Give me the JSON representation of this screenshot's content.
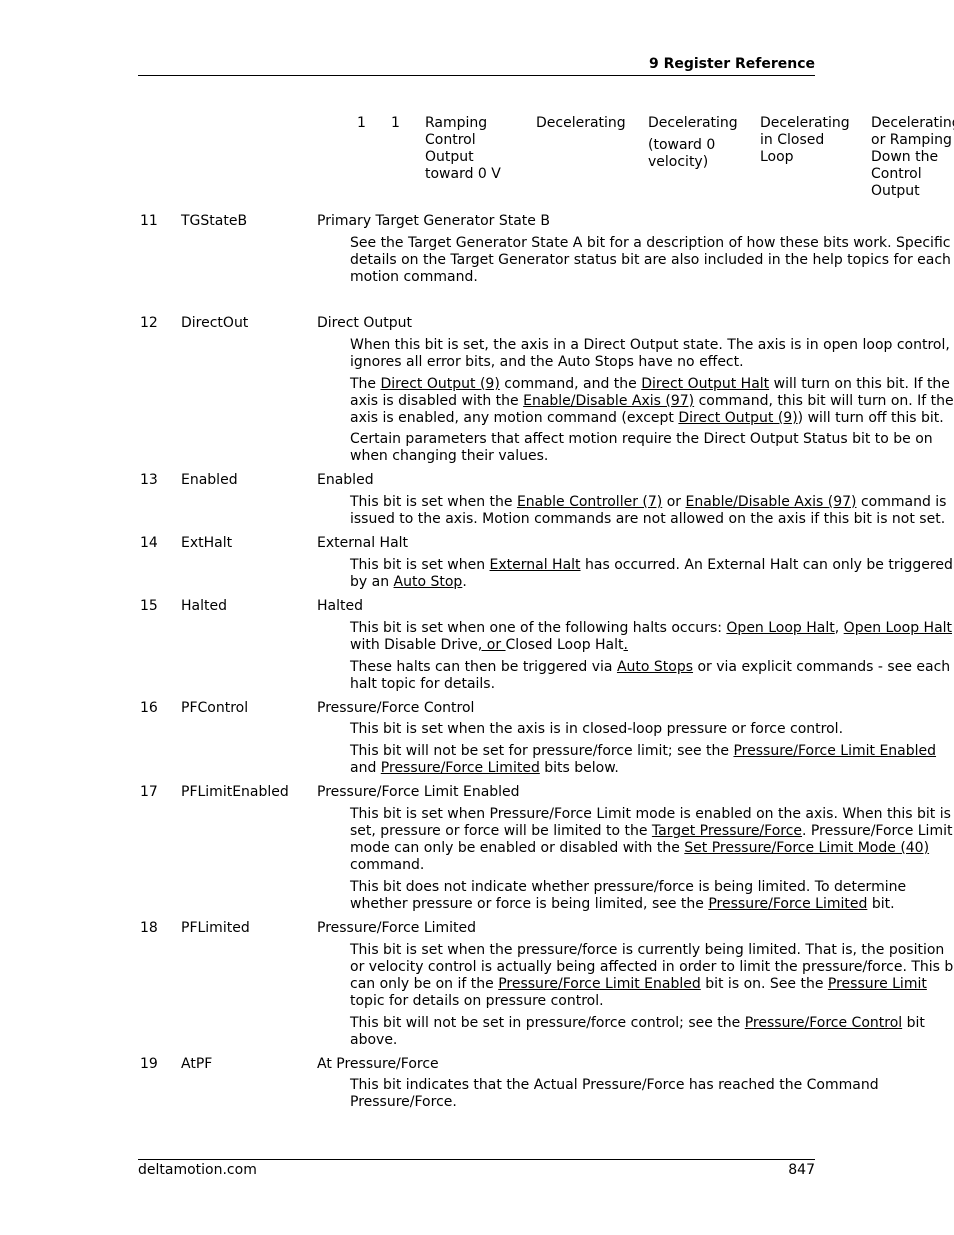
{
  "header": {
    "title": "9  Register Reference"
  },
  "table_row": {
    "col_a": "1",
    "col_b": "1",
    "cells": [
      [
        "Ramping",
        "Control",
        "Output",
        "toward 0 V"
      ],
      [
        "Decelerating"
      ],
      [
        "Decelerating",
        "(toward 0",
        "velocity)"
      ],
      [
        "Decelerating",
        "in Closed",
        "Loop"
      ],
      [
        "Decelerating",
        "or Ramping",
        "Down the",
        "Control",
        "Output"
      ]
    ]
  },
  "bits": [
    {
      "num": "11",
      "name": "TGStateB",
      "title": "Primary Target Generator State B",
      "lines": [
        "See the Target Generator State A bit for a description of how these bits work. Specific",
        "details on the Target Generator status bit are also included in the help topics for each",
        "motion command."
      ]
    },
    {
      "num": "12",
      "name": "DirectOut",
      "title": "Direct Output",
      "lines": [
        "When this bit is set, the axis in a Direct Output state. The axis is in open loop control,",
        "ignores all error bits, and the Auto Stops have no effect.",
        "The |Direct Output (9)| command, and the |Direct Output Halt| will turn on this bit. If the",
        "axis is disabled with the |Enable/Disable Axis (97)| command, this bit will turn on. If the",
        "axis is enabled, any motion command (except |Direct Output (9)|) will turn off this bit.",
        "Certain parameters that affect motion require the Direct Output Status bit to be on",
        "when changing their values."
      ]
    },
    {
      "num": "13",
      "name": "Enabled",
      "title": "Enabled",
      "lines": [
        "This bit is set when the |Enable Controller (7)| or |Enable/Disable Axis (97)| command is",
        "issued to the axis.  Motion commands are not allowed on the axis if this bit is not set."
      ]
    },
    {
      "num": "14",
      "name": "ExtHalt",
      "title": "External Halt",
      "lines": [
        "This bit is set when |External Halt| has occurred. An External Halt can only be triggered",
        "by an |Auto Stop|."
      ]
    },
    {
      "num": "15",
      "name": "Halted",
      "title": "Halted",
      "lines": [
        "This bit is set when one of the following halts occurs: |Open Loop Halt|, |Open Loop Halt",
        "with Disable Drive|, or |Closed Loop Halt|.",
        "These halts can then be triggered via |Auto Stops| or via explicit commands - see each",
        "halt topic for details."
      ]
    },
    {
      "num": "16",
      "name": "PFControl",
      "title": "Pressure/Force Control",
      "lines": [
        "This bit is set when the axis is in closed-loop pressure or force control.",
        "This bit will not be set for pressure/force limit; see the |Pressure/Force Limit Enabled|",
        "and |Pressure/Force Limited| bits below."
      ]
    },
    {
      "num": "17",
      "name": "PFLimitEnabled",
      "title": "Pressure/Force Limit Enabled",
      "lines": [
        "This bit is set when Pressure/Force Limit mode is enabled on the axis. When this bit is",
        "set, pressure or force will be limited to the |Target Pressure/Force|. Pressure/Force Limit",
        "mode can only be enabled or disabled with the |Set Pressure/Force Limit Mode (40)|",
        "command.",
        "This bit does not indicate whether pressure/force is being limited. To determine",
        "whether pressure or force is being limited, see the |Pressure/Force Limited| bit."
      ]
    },
    {
      "num": "18",
      "name": "PFLimited",
      "title": "Pressure/Force Limited",
      "lines": [
        "This bit is set when the pressure/force is currently being limited. That is, the position",
        "or velocity control is actually being affected in order to limit the pressure/force. This bit",
        "can only be on if the |Pressure/Force Limit Enabled| bit is on. See the |Pressure Limit|",
        "topic for details on pressure control.",
        "This bit will not be set in pressure/force control; see the |Pressure/Force Control| bit",
        "above."
      ]
    },
    {
      "num": "19",
      "name": "AtPF",
      "title": "At Pressure/Force",
      "lines": [
        "This bit indicates that the Actual Pressure/Force has reached the Command",
        "Pressure/Force."
      ]
    }
  ],
  "footer": {
    "site": "deltamotion.com",
    "page": "847"
  }
}
